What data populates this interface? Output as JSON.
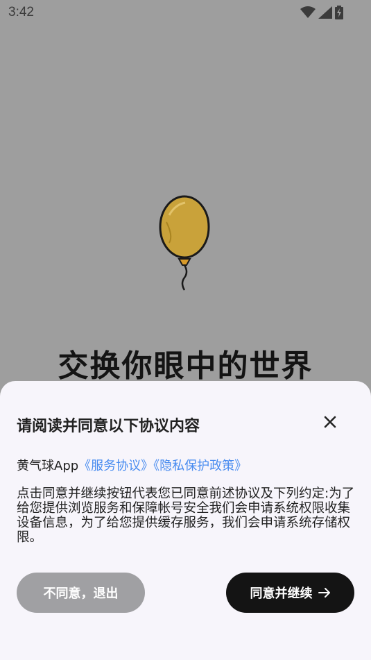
{
  "status_bar": {
    "time": "3:42",
    "icons": [
      "wifi-icon",
      "signal-icon",
      "battery-charging-icon"
    ]
  },
  "hero": {
    "slogan": "交换你眼中的世界",
    "image": "balloon-illustration"
  },
  "dialog": {
    "title": "请阅读并同意以下协议内容",
    "app_name": "黄气球App",
    "link_terms": "《服务协议》",
    "link_privacy": "《隐私保护政策》",
    "body": "点击同意并继续按钮代表您已同意前述协议及下列约定:为了给您提供浏览服务和保障帐号安全我们会申请系统权限收集设备信息，为了给您提供缓存服务，我们会申请系统存储权限。",
    "disagree_label": "不同意，退出",
    "agree_label": "同意并继续",
    "colors": {
      "link": "#4a8df0",
      "agree_bg": "#141414",
      "disagree_bg": "#a0a0a3",
      "sheet_bg": "#f7f5fb",
      "balloon": "#c9a23a"
    }
  }
}
